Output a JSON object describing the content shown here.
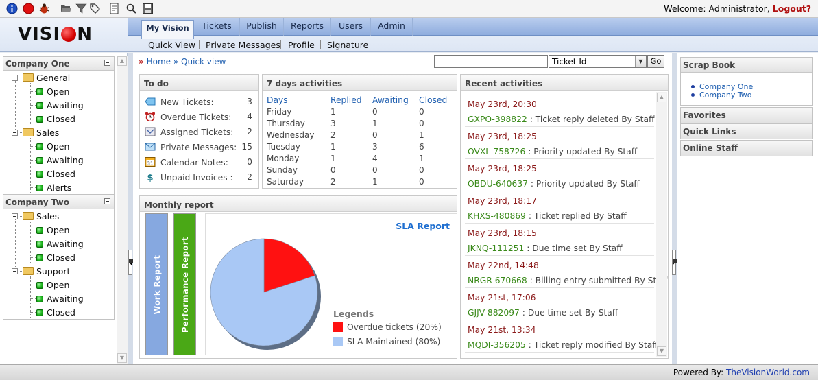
{
  "welcome": {
    "text": "Welcome: Administrator,",
    "logout": "Logout?"
  },
  "toolbar_icons": [
    "info-icon",
    "stop-icon",
    "bug-icon",
    "folder-open-icon",
    "funnel-icon",
    "tags-icon",
    "document-icon",
    "magnifier-icon",
    "save-icon"
  ],
  "logo": {
    "left": "VISI",
    "right": "N"
  },
  "main_nav": [
    "My Vision",
    "Tickets",
    "Publish",
    "Reports",
    "Users",
    "Admin"
  ],
  "sub_nav": [
    "Quick View",
    "Private Messages",
    "Profile",
    "Signature"
  ],
  "breadcrumb": {
    "home": "Home",
    "current": "Quick view"
  },
  "search": {
    "value": "",
    "select_value": "Ticket Id",
    "go": "Go"
  },
  "left_tree": {
    "company_one": {
      "title": "Company One",
      "groups": [
        {
          "name": "General",
          "items": [
            "Open",
            "Awaiting",
            "Closed"
          ]
        },
        {
          "name": "Sales",
          "items": [
            "Open",
            "Awaiting",
            "Closed",
            "Alerts"
          ]
        }
      ]
    },
    "company_two": {
      "title": "Company Two",
      "groups": [
        {
          "name": "Sales",
          "items": [
            "Open",
            "Awaiting",
            "Closed"
          ]
        },
        {
          "name": "Support",
          "items": [
            "Open",
            "Awaiting",
            "Closed"
          ]
        }
      ]
    }
  },
  "todo": {
    "title": "To do",
    "rows": [
      {
        "label": "New Tickets:",
        "count": "3",
        "icon": "ticket-icon"
      },
      {
        "label": "Overdue Tickets:",
        "count": "4",
        "icon": "alarm-clock-icon"
      },
      {
        "label": "Assigned Tickets:",
        "count": "2",
        "icon": "assigned-icon"
      },
      {
        "label": "Private Messages:",
        "count": "15",
        "icon": "envelope-icon"
      },
      {
        "label": "Calendar Notes:",
        "count": "0",
        "icon": "calendar-icon"
      },
      {
        "label": "Unpaid Invoices :",
        "count": "2",
        "icon": "dollar-icon"
      }
    ]
  },
  "activities": {
    "title": "7 days activities",
    "headers": [
      "Days",
      "Replied",
      "Awaiting",
      "Closed"
    ],
    "rows": [
      [
        "Friday",
        "1",
        "0",
        "0"
      ],
      [
        "Thursday",
        "3",
        "1",
        "0"
      ],
      [
        "Wednesday",
        "2",
        "0",
        "1"
      ],
      [
        "Tuesday",
        "1",
        "3",
        "6"
      ],
      [
        "Monday",
        "1",
        "4",
        "1"
      ],
      [
        "Sunday",
        "0",
        "0",
        "0"
      ],
      [
        "Saturday",
        "2",
        "1",
        "0"
      ]
    ]
  },
  "monthly": {
    "title": "Monthly report",
    "work_tab": "Work Report",
    "performance_tab": "Performance Report",
    "sla_title": "SLA Report",
    "legend_title": "Legends",
    "legend": [
      {
        "label": "Overdue tickets (20%)",
        "color": "#ff1111"
      },
      {
        "label": "SLA Maintained (80%)",
        "color": "#a9c8f5"
      }
    ],
    "work_color": "#86a8e0",
    "performance_color": "#4aa816"
  },
  "chart_data": {
    "type": "pie",
    "title": "SLA Report",
    "categories": [
      "Overdue tickets",
      "SLA Maintained"
    ],
    "values": [
      20,
      80
    ],
    "colors": [
      "#ff1111",
      "#a9c8f5"
    ]
  },
  "recent": {
    "title": "Recent activities",
    "items": [
      {
        "when": "May 23rd, 20:30",
        "id": "GXPO-398822",
        "text": " : Ticket reply deleted By Staff"
      },
      {
        "when": "May 23rd, 18:25",
        "id": "OVXL-758726",
        "text": " : Priority updated By Staff"
      },
      {
        "when": "May 23rd, 18:25",
        "id": "OBDU-640637",
        "text": " : Priority updated By Staff"
      },
      {
        "when": "May 23rd, 18:17",
        "id": "KHXS-480869",
        "text": " : Ticket replied By Staff"
      },
      {
        "when": "May 23rd, 18:15",
        "id": "JKNQ-111251",
        "text": " : Due time set By Staff"
      },
      {
        "when": "May 22nd, 14:48",
        "id": "NRGR-670668",
        "text": " : Billing entry submitted By Staff"
      },
      {
        "when": "May 21st, 17:06",
        "id": "GJJV-882097",
        "text": " : Due time set By Staff"
      },
      {
        "when": "May 21st, 13:34",
        "id": "MQDI-356205",
        "text": " : Ticket reply modified By Staff"
      }
    ]
  },
  "right": {
    "scrap_title": "Scrap Book",
    "scrap_items": [
      "Company One",
      "Company Two"
    ],
    "favorites": "Favorites",
    "quick_links": "Quick Links",
    "online_staff": "Online Staff"
  },
  "footer": {
    "label": "Powered By:",
    "link": "TheVisionWorld.com"
  }
}
